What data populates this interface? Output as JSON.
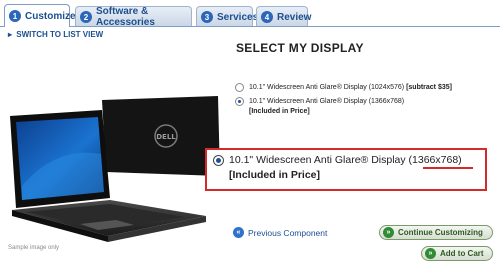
{
  "tabs": [
    {
      "num": "1",
      "label": "Customize",
      "active": true
    },
    {
      "num": "2",
      "label": "Software & Accessories",
      "active": false
    },
    {
      "num": "3",
      "label": "Services",
      "active": false
    },
    {
      "num": "4",
      "label": "Review",
      "active": false
    }
  ],
  "switch_view": {
    "arrow": "▸",
    "label": "SWITCH TO LIST VIEW"
  },
  "section_title": "SELECT MY DISPLAY",
  "options": [
    {
      "label": "10.1\" Widescreen Anti Glare® Display (1024x576)",
      "extra": "[subtract $35]",
      "selected": false
    },
    {
      "label": "10.1\" Widescreen Anti Glare® Display (1366x768)",
      "price": "[Included in Price]",
      "selected": true
    }
  ],
  "zoom": {
    "label_main": "10.1\" Widescreen Anti Glare® Display ",
    "label_highlight": "(1366x768)",
    "price": "[Included in Price]"
  },
  "laptop_brand": "DELL",
  "sample_note": "Sample image only",
  "actions": {
    "previous": {
      "icon": "«",
      "label": "Previous Component"
    },
    "continue": {
      "icon": "»",
      "label": "Continue Customizing"
    },
    "cart": {
      "icon": "»",
      "label": "Add to Cart"
    }
  },
  "colors": {
    "accent": "#1d4f8f",
    "highlight_border": "#d42a2a",
    "button_green": "#2f8c35"
  }
}
